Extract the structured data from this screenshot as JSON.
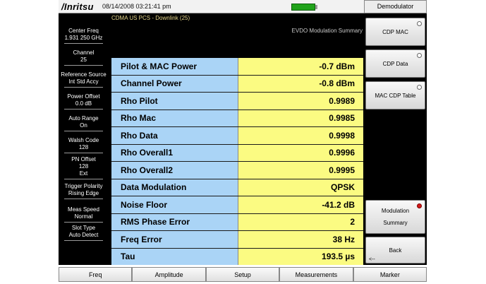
{
  "header": {
    "logo_text": "/Inritsu",
    "datetime": "08/14/2008 03:21:41 pm",
    "battery_color": "#21a31b"
  },
  "mode": {
    "title": "CDMA US PCS - Downlink (25)",
    "summary_title": "EVDO Modulation Summary"
  },
  "left_params": [
    {
      "label": "Center Freq",
      "value": "1.931 250 GHz"
    },
    {
      "label": "Channel",
      "value": "25"
    },
    {
      "label": "Reference Source",
      "value": "Int Std Accy"
    },
    {
      "label": "Power Offset",
      "value": "0.0 dB"
    },
    {
      "label": "Auto Range",
      "value": "On"
    },
    {
      "label": "Walsh Code",
      "value": "128"
    },
    {
      "label": "PN Offset",
      "value": "128",
      "extra": "Ext"
    },
    {
      "label": "Trigger Polarity",
      "value": "Rising Edge"
    },
    {
      "label": "Meas Speed",
      "value": "Normal"
    },
    {
      "label": "Slot Type",
      "value": "Auto Detect"
    }
  ],
  "results": [
    {
      "name": "Pilot & MAC Power",
      "value": "-0.7 dBm"
    },
    {
      "name": "Channel Power",
      "value": "-0.8 dBm"
    },
    {
      "name": "Rho Pilot",
      "value": "0.9989"
    },
    {
      "name": "Rho Mac",
      "value": "0.9985"
    },
    {
      "name": "Rho Data",
      "value": "0.9998"
    },
    {
      "name": "Rho Overall1",
      "value": "0.9996"
    },
    {
      "name": "Rho Overall2",
      "value": "0.9995"
    },
    {
      "name": "Data Modulation",
      "value": "QPSK"
    },
    {
      "name": "Noise Floor",
      "value": "-41.2 dB"
    },
    {
      "name": "RMS Phase Error",
      "value": "2"
    },
    {
      "name": "Freq Error",
      "value": "38 Hz"
    },
    {
      "name": "Tau",
      "value": "193.5 µs"
    }
  ],
  "softkeys": {
    "menu_title": "Demodulator",
    "cdp_mac": "CDP MAC",
    "cdp_data": "CDP Data",
    "mac_cdp_table": "MAC CDP Table",
    "modulation": "Modulation",
    "summary": "Summary",
    "back": "Back",
    "back_marker": "<--",
    "active_color": "#d41a1a"
  },
  "bottom_menu": [
    "Freq",
    "Amplitude",
    "Setup",
    "Measurements",
    "Marker"
  ]
}
